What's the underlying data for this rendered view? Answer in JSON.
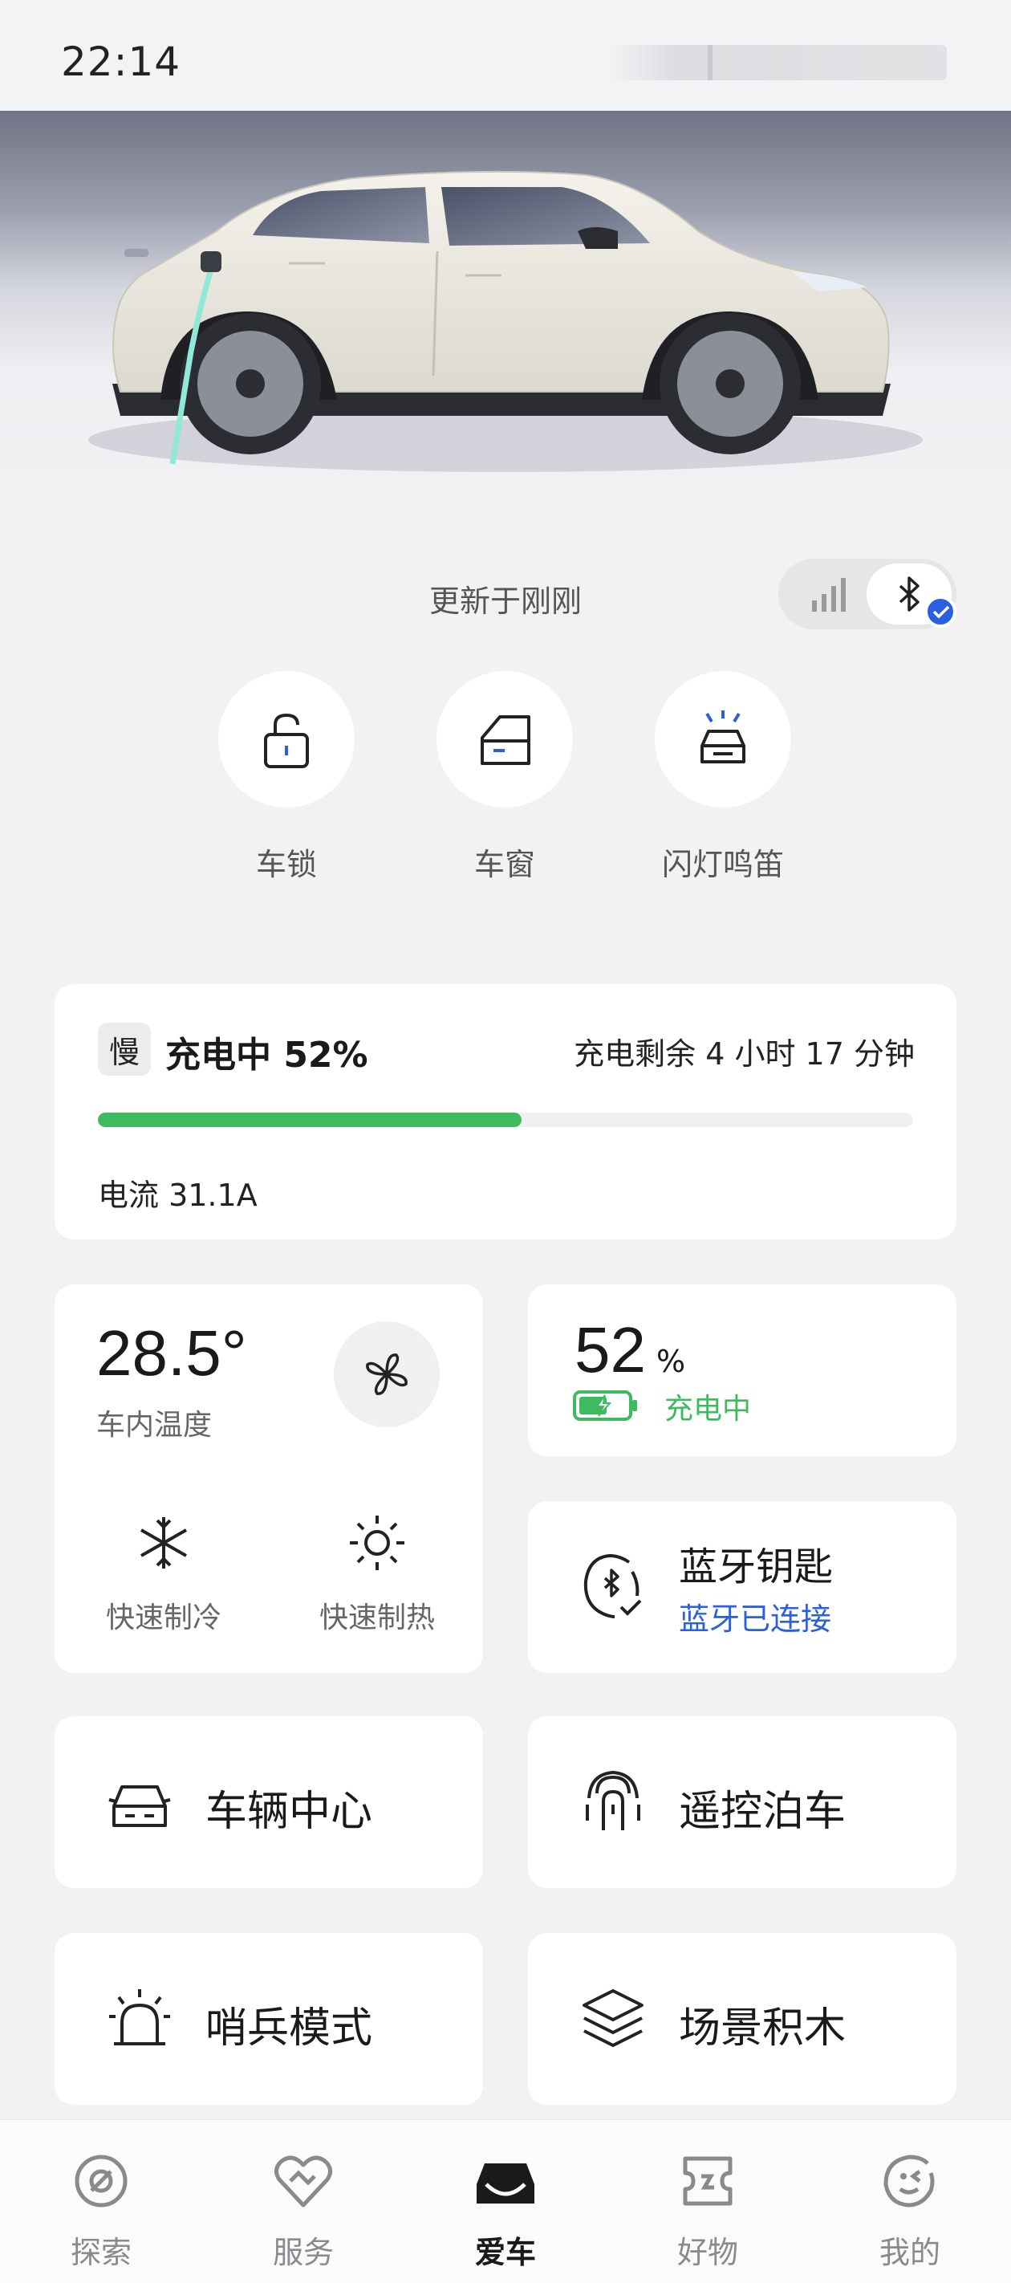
{
  "status_bar": {
    "time": "22:14"
  },
  "vehicle": {
    "update_text": "更新于刚刚",
    "connection_mode": "bluetooth",
    "quick_actions": [
      {
        "label": "车锁",
        "icon": "lock-icon"
      },
      {
        "label": "车窗",
        "icon": "window-icon"
      },
      {
        "label": "闪灯鸣笛",
        "icon": "flash-horn-icon"
      }
    ]
  },
  "charging": {
    "mode_badge": "慢",
    "status": "充电中 52%",
    "remaining": "充电剩余 4 小时 17 分钟",
    "progress": 0.52,
    "current": "电流 31.1A",
    "color": "#3dbb5e"
  },
  "climate": {
    "temperature": "28.5°",
    "temperature_label": "车内温度",
    "cool_label": "快速制冷",
    "heat_label": "快速制热"
  },
  "battery": {
    "percent": "52",
    "unit": "%",
    "status": "充电中"
  },
  "bluetooth_key": {
    "title": "蓝牙钥匙",
    "status": "蓝牙已连接",
    "status_color": "#2a5fe0"
  },
  "tiles": [
    {
      "label": "车辆中心",
      "icon": "car-front-icon"
    },
    {
      "label": "遥控泊车",
      "icon": "remote-parking-icon"
    },
    {
      "label": "哨兵模式",
      "icon": "sentry-alarm-icon"
    },
    {
      "label": "场景积木",
      "icon": "layers-icon"
    }
  ],
  "bottom_nav": [
    {
      "label": "探索",
      "icon": "explore-icon",
      "active": false
    },
    {
      "label": "服务",
      "icon": "service-heart-icon",
      "active": false
    },
    {
      "label": "爱车",
      "icon": "car-icon",
      "active": true
    },
    {
      "label": "好物",
      "icon": "ticket-icon",
      "active": false
    },
    {
      "label": "我的",
      "icon": "profile-face-icon",
      "active": false
    }
  ]
}
